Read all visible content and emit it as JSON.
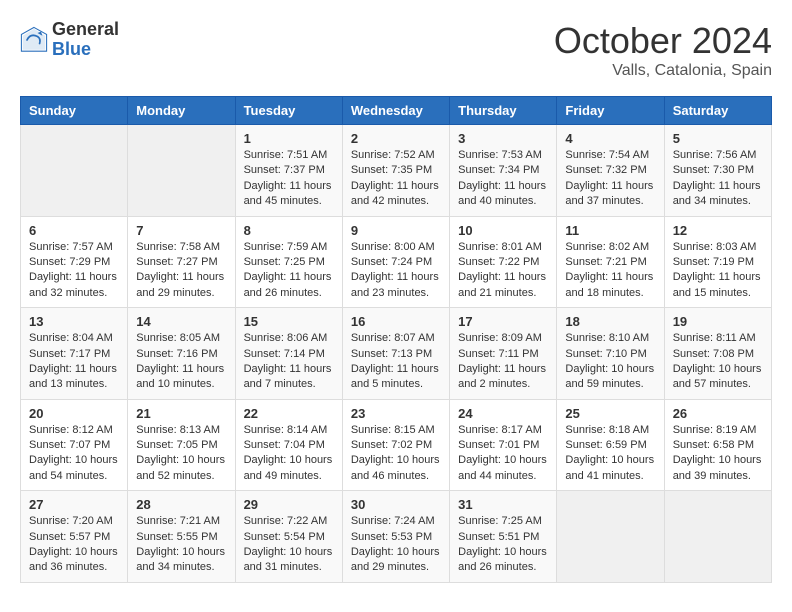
{
  "header": {
    "logo": {
      "general": "General",
      "blue": "Blue"
    },
    "title": "October 2024",
    "location": "Valls, Catalonia, Spain"
  },
  "calendar": {
    "days_of_week": [
      "Sunday",
      "Monday",
      "Tuesday",
      "Wednesday",
      "Thursday",
      "Friday",
      "Saturday"
    ],
    "weeks": [
      [
        {
          "day": "",
          "info": ""
        },
        {
          "day": "",
          "info": ""
        },
        {
          "day": "1",
          "info": "Sunrise: 7:51 AM\nSunset: 7:37 PM\nDaylight: 11 hours and 45 minutes."
        },
        {
          "day": "2",
          "info": "Sunrise: 7:52 AM\nSunset: 7:35 PM\nDaylight: 11 hours and 42 minutes."
        },
        {
          "day": "3",
          "info": "Sunrise: 7:53 AM\nSunset: 7:34 PM\nDaylight: 11 hours and 40 minutes."
        },
        {
          "day": "4",
          "info": "Sunrise: 7:54 AM\nSunset: 7:32 PM\nDaylight: 11 hours and 37 minutes."
        },
        {
          "day": "5",
          "info": "Sunrise: 7:56 AM\nSunset: 7:30 PM\nDaylight: 11 hours and 34 minutes."
        }
      ],
      [
        {
          "day": "6",
          "info": "Sunrise: 7:57 AM\nSunset: 7:29 PM\nDaylight: 11 hours and 32 minutes."
        },
        {
          "day": "7",
          "info": "Sunrise: 7:58 AM\nSunset: 7:27 PM\nDaylight: 11 hours and 29 minutes."
        },
        {
          "day": "8",
          "info": "Sunrise: 7:59 AM\nSunset: 7:25 PM\nDaylight: 11 hours and 26 minutes."
        },
        {
          "day": "9",
          "info": "Sunrise: 8:00 AM\nSunset: 7:24 PM\nDaylight: 11 hours and 23 minutes."
        },
        {
          "day": "10",
          "info": "Sunrise: 8:01 AM\nSunset: 7:22 PM\nDaylight: 11 hours and 21 minutes."
        },
        {
          "day": "11",
          "info": "Sunrise: 8:02 AM\nSunset: 7:21 PM\nDaylight: 11 hours and 18 minutes."
        },
        {
          "day": "12",
          "info": "Sunrise: 8:03 AM\nSunset: 7:19 PM\nDaylight: 11 hours and 15 minutes."
        }
      ],
      [
        {
          "day": "13",
          "info": "Sunrise: 8:04 AM\nSunset: 7:17 PM\nDaylight: 11 hours and 13 minutes."
        },
        {
          "day": "14",
          "info": "Sunrise: 8:05 AM\nSunset: 7:16 PM\nDaylight: 11 hours and 10 minutes."
        },
        {
          "day": "15",
          "info": "Sunrise: 8:06 AM\nSunset: 7:14 PM\nDaylight: 11 hours and 7 minutes."
        },
        {
          "day": "16",
          "info": "Sunrise: 8:07 AM\nSunset: 7:13 PM\nDaylight: 11 hours and 5 minutes."
        },
        {
          "day": "17",
          "info": "Sunrise: 8:09 AM\nSunset: 7:11 PM\nDaylight: 11 hours and 2 minutes."
        },
        {
          "day": "18",
          "info": "Sunrise: 8:10 AM\nSunset: 7:10 PM\nDaylight: 10 hours and 59 minutes."
        },
        {
          "day": "19",
          "info": "Sunrise: 8:11 AM\nSunset: 7:08 PM\nDaylight: 10 hours and 57 minutes."
        }
      ],
      [
        {
          "day": "20",
          "info": "Sunrise: 8:12 AM\nSunset: 7:07 PM\nDaylight: 10 hours and 54 minutes."
        },
        {
          "day": "21",
          "info": "Sunrise: 8:13 AM\nSunset: 7:05 PM\nDaylight: 10 hours and 52 minutes."
        },
        {
          "day": "22",
          "info": "Sunrise: 8:14 AM\nSunset: 7:04 PM\nDaylight: 10 hours and 49 minutes."
        },
        {
          "day": "23",
          "info": "Sunrise: 8:15 AM\nSunset: 7:02 PM\nDaylight: 10 hours and 46 minutes."
        },
        {
          "day": "24",
          "info": "Sunrise: 8:17 AM\nSunset: 7:01 PM\nDaylight: 10 hours and 44 minutes."
        },
        {
          "day": "25",
          "info": "Sunrise: 8:18 AM\nSunset: 6:59 PM\nDaylight: 10 hours and 41 minutes."
        },
        {
          "day": "26",
          "info": "Sunrise: 8:19 AM\nSunset: 6:58 PM\nDaylight: 10 hours and 39 minutes."
        }
      ],
      [
        {
          "day": "27",
          "info": "Sunrise: 7:20 AM\nSunset: 5:57 PM\nDaylight: 10 hours and 36 minutes."
        },
        {
          "day": "28",
          "info": "Sunrise: 7:21 AM\nSunset: 5:55 PM\nDaylight: 10 hours and 34 minutes."
        },
        {
          "day": "29",
          "info": "Sunrise: 7:22 AM\nSunset: 5:54 PM\nDaylight: 10 hours and 31 minutes."
        },
        {
          "day": "30",
          "info": "Sunrise: 7:24 AM\nSunset: 5:53 PM\nDaylight: 10 hours and 29 minutes."
        },
        {
          "day": "31",
          "info": "Sunrise: 7:25 AM\nSunset: 5:51 PM\nDaylight: 10 hours and 26 minutes."
        },
        {
          "day": "",
          "info": ""
        },
        {
          "day": "",
          "info": ""
        }
      ]
    ]
  }
}
